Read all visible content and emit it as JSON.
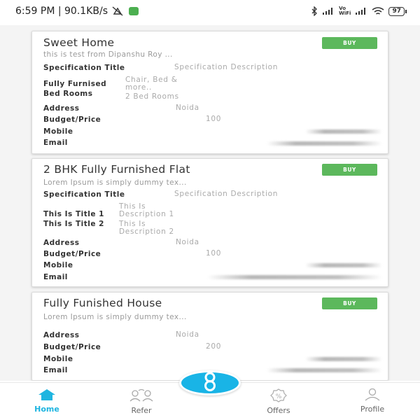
{
  "status_bar": {
    "time_speed": "6:59 PM | 90.1KB/s",
    "vowifi_top": "Vo",
    "vowifi_bottom": "WiFi",
    "battery": "97"
  },
  "colors": {
    "accent": "#1fb5e0",
    "buy_button": "#5cb85c",
    "muted_text": "#aaaaaa"
  },
  "listings": [
    {
      "title": "Sweet Home",
      "buy_label": "BUY",
      "subtitle": "this is test from Dipanshu Roy ...",
      "spec_title": "Specification Title",
      "spec_desc": "Specification Description",
      "specs": [
        {
          "label": "Fully Furnised",
          "value_lines": [
            "Chair, Bed &",
            "more.."
          ]
        },
        {
          "label": "Bed Rooms",
          "value_lines": [
            "2 Bed Rooms"
          ]
        }
      ],
      "address_label": "Address",
      "address": "Noida",
      "budget_label": "Budget/Price",
      "budget": "100",
      "mobile_label": "Mobile",
      "email_label": "Email"
    },
    {
      "title": "2 BHK Fully Furnished Flat",
      "buy_label": "BUY",
      "subtitle": "Lorem Ipsum is simply dummy tex...",
      "spec_title": "Specification Title",
      "spec_desc": "Specification Description",
      "specs": [
        {
          "label": "This Is Title 1",
          "value_lines": [
            "This Is",
            "Description 1"
          ]
        },
        {
          "label": "This Is Title 2",
          "value_lines": [
            "This Is",
            "Description 2"
          ]
        }
      ],
      "address_label": "Address",
      "address": "Noida",
      "budget_label": "Budget/Price",
      "budget": "100",
      "mobile_label": "Mobile",
      "email_label": "Email"
    },
    {
      "title": "Fully Funished House",
      "buy_label": "BUY",
      "subtitle": "Lorem Ipsum is simply dummy tex...",
      "address_label": "Address",
      "address": "Noida",
      "budget_label": "Budget/Price",
      "budget": "200",
      "mobile_label": "Mobile",
      "email_label": "Email"
    }
  ],
  "bottom_nav": {
    "home": "Home",
    "refer": "Refer",
    "offers": "Offers",
    "profile": "Profile",
    "center_icon": "eight-logo-icon"
  }
}
